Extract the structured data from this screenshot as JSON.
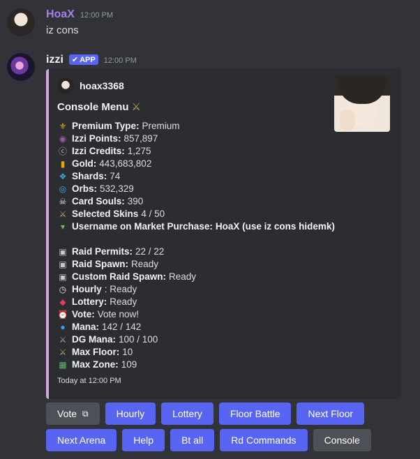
{
  "message1": {
    "username": "HoaX",
    "time": "12:00 PM",
    "content": "iz cons"
  },
  "message2": {
    "username": "izzi",
    "badge": "APP",
    "time": "12:00 PM",
    "embed": {
      "author": "hoax3368",
      "title": "Console Menu",
      "title_icon": "crossed-swords-icon",
      "accent_color": "#d7a7e3",
      "footer": "Today at 12:00 PM",
      "lines": [
        {
          "icon": "premium-icon",
          "glyph": "⚜",
          "color": "#e0b000",
          "label": "Premium Type:",
          "value": "Premium"
        },
        {
          "icon": "izzi-points-icon",
          "glyph": "◉",
          "color": "#9b59b6",
          "label": "Izzi Points:",
          "value": "857,897"
        },
        {
          "icon": "izzi-credits-icon",
          "glyph": "ⓒ",
          "color": "#b9bbbe",
          "label": "Izzi Credits:",
          "value": "1,275"
        },
        {
          "icon": "gold-icon",
          "glyph": "▮",
          "color": "#e6a700",
          "label": "Gold:",
          "value": "443,683,802"
        },
        {
          "icon": "shards-icon",
          "glyph": "❖",
          "color": "#3fa9d6",
          "label": "Shards:",
          "value": "74"
        },
        {
          "icon": "orbs-icon",
          "glyph": "◎",
          "color": "#3fa9f5",
          "label": "Orbs:",
          "value": "532,329"
        },
        {
          "icon": "skull-icon",
          "glyph": "☠",
          "color": "#e3e5e8",
          "label": "Card Souls:",
          "value": "390"
        },
        {
          "icon": "crossed-swords-icon",
          "glyph": "⚔",
          "color": "#c9a86a",
          "label": "Selected Skins",
          "value": "4 / 50"
        },
        {
          "icon": "market-icon",
          "glyph": "▾",
          "color": "#6cc24a",
          "label": "Username on Market Purchase:",
          "value": "HoaX (use iz cons hidemk)",
          "bold_value": true
        },
        {
          "gap": true
        },
        {
          "icon": "ticket-icon",
          "glyph": "▣",
          "color": "#c8c8c8",
          "label": "Raid Permits:",
          "value": "22 / 22"
        },
        {
          "icon": "ticket-icon",
          "glyph": "▣",
          "color": "#c8c8c8",
          "label": "Raid Spawn:",
          "value": "Ready"
        },
        {
          "icon": "ticket-icon",
          "glyph": "▣",
          "color": "#c8c8c8",
          "label": "Custom Raid Spawn:",
          "value": "Ready"
        },
        {
          "icon": "clock-icon",
          "glyph": "◷",
          "color": "#e3e5e8",
          "label": "Hourly",
          "value": ": Ready"
        },
        {
          "icon": "lottery-ticket-icon",
          "glyph": "◆",
          "color": "#e23c5a",
          "label": "Lottery:",
          "value": "Ready"
        },
        {
          "icon": "alarm-clock-icon",
          "glyph": "⏰",
          "color": "#e23c3c",
          "label": "Vote:",
          "value": "Vote now!"
        },
        {
          "icon": "droplet-icon",
          "glyph": "●",
          "color": "#3b9df0",
          "label": "Mana:",
          "value": "142 / 142"
        },
        {
          "icon": "sword-icon",
          "glyph": "⚔",
          "color": "#9aa9b8",
          "label": "DG Mana:",
          "value": "100 / 100"
        },
        {
          "icon": "crossed-swords-icon",
          "glyph": "⚔",
          "color": "#c9a86a",
          "label": "Max Floor:",
          "value": "10"
        },
        {
          "icon": "map-icon",
          "glyph": "▦",
          "color": "#5fb36b",
          "label": "Max Zone:",
          "value": "109"
        }
      ]
    }
  },
  "buttons": {
    "row1": [
      {
        "name": "vote-button",
        "label": "Vote",
        "style": "secondary",
        "external": true
      },
      {
        "name": "hourly-button",
        "label": "Hourly",
        "style": "primary"
      },
      {
        "name": "lottery-button",
        "label": "Lottery",
        "style": "primary"
      },
      {
        "name": "floor-battle-button",
        "label": "Floor Battle",
        "style": "primary"
      },
      {
        "name": "next-floor-button",
        "label": "Next Floor",
        "style": "primary"
      }
    ],
    "row2": [
      {
        "name": "next-arena-button",
        "label": "Next Arena",
        "style": "primary"
      },
      {
        "name": "help-button",
        "label": "Help",
        "style": "primary"
      },
      {
        "name": "bt-all-button",
        "label": "Bt all",
        "style": "primary"
      },
      {
        "name": "rd-commands-button",
        "label": "Rd Commands",
        "style": "primary"
      },
      {
        "name": "console-button",
        "label": "Console",
        "style": "secondary"
      }
    ]
  }
}
